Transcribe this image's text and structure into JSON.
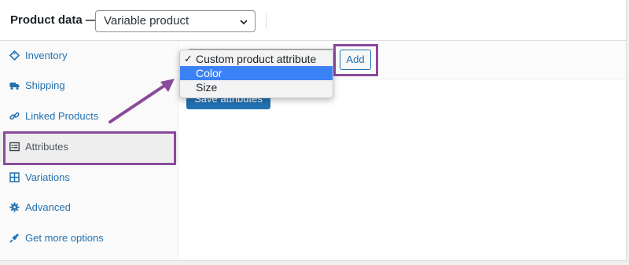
{
  "header": {
    "label": "Product data —",
    "product_type": "Variable product"
  },
  "tabs": [
    {
      "label": "Inventory",
      "icon": "diamond-tag-icon"
    },
    {
      "label": "Shipping",
      "icon": "truck-icon"
    },
    {
      "label": "Linked Products",
      "icon": "link-icon"
    },
    {
      "label": "Attributes",
      "icon": "list-icon",
      "active": true
    },
    {
      "label": "Variations",
      "icon": "grid-icon"
    },
    {
      "label": "Advanced",
      "icon": "gear-icon"
    },
    {
      "label": "Get more options",
      "icon": "plug-icon"
    }
  ],
  "attributes": {
    "options": [
      "Custom product attribute",
      "Color",
      "Size"
    ],
    "selected": "Custom product attribute",
    "hovered": "Color",
    "add_label": "Add",
    "save_label": "Save attributes"
  },
  "colors": {
    "accent": "#2271b1",
    "highlight": "#8a4a9b",
    "hover": "#3b82f6"
  }
}
